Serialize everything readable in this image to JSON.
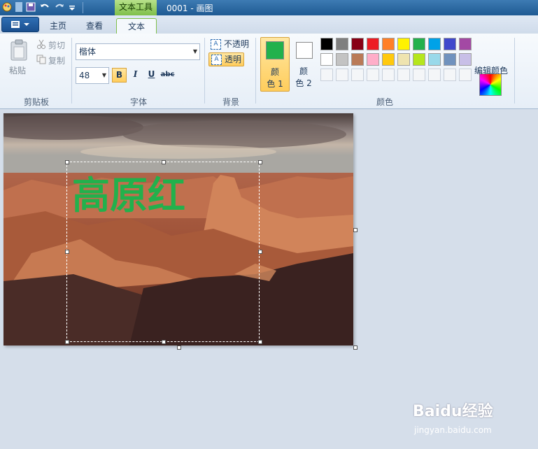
{
  "window": {
    "context_tab": "文本工具",
    "doc_title": "0001 - 画图"
  },
  "tabs": [
    {
      "label": "主页"
    },
    {
      "label": "查看"
    },
    {
      "label": "文本"
    }
  ],
  "clipboard": {
    "paste": "粘贴",
    "cut": "剪切",
    "copy": "复制",
    "group": "剪贴板"
  },
  "font": {
    "family": "楷体",
    "size": "48",
    "bold": "B",
    "italic": "I",
    "underline": "U",
    "strike": "abc",
    "group": "字体"
  },
  "background": {
    "opaque": "不透明",
    "transparent": "透明",
    "group": "背景"
  },
  "colors": {
    "color1_line1": "颜",
    "color1_line2": "色 1",
    "color2_line1": "颜",
    "color2_line2": "色 2",
    "edit": "编辑颜色",
    "group": "颜色",
    "color1_value": "#22b14c",
    "color2_value": "#ffffff",
    "palette_row1": [
      "#000000",
      "#7f7f7f",
      "#880015",
      "#ed1c24",
      "#ff7f27",
      "#fff200",
      "#22b14c",
      "#00a2e8",
      "#3f48cc",
      "#a349a4"
    ],
    "palette_row2": [
      "#ffffff",
      "#c3c3c3",
      "#b97a57",
      "#ffaec9",
      "#ffc90e",
      "#efe4b0",
      "#b5e61d",
      "#99d9ea",
      "#7092be",
      "#c8bfe7"
    ]
  },
  "canvas": {
    "text": "高原红",
    "text_color": "#22b14c"
  },
  "watermark": {
    "brand": "Baidu经验",
    "url": "jingyan.baidu.com"
  }
}
